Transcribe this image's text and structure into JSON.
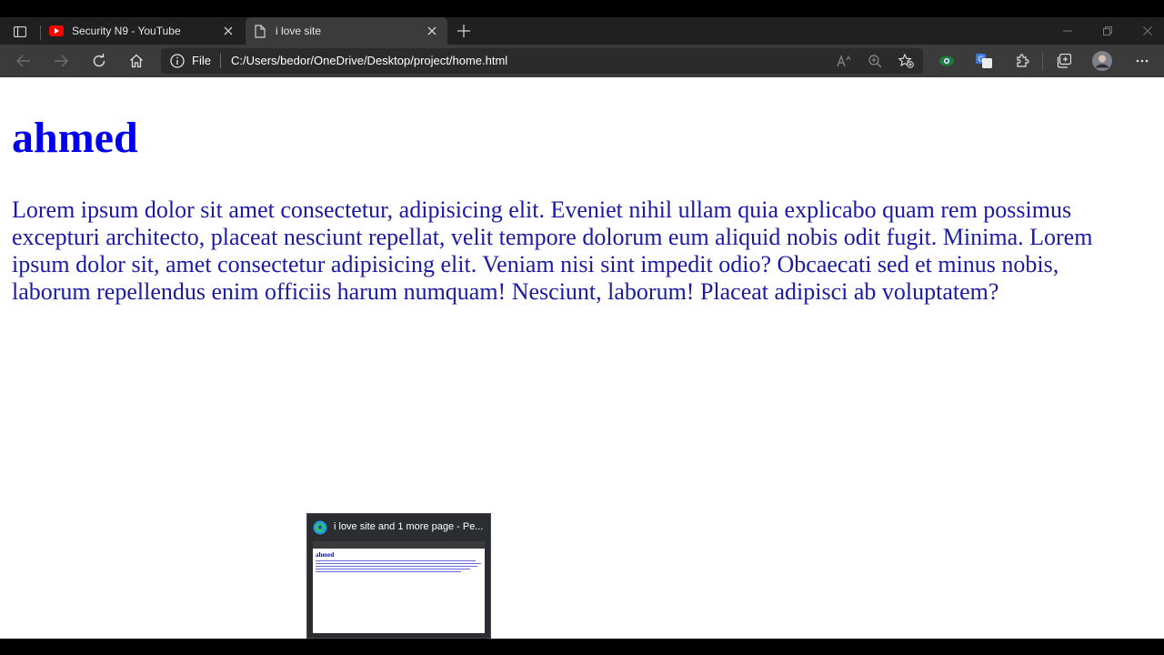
{
  "browser": {
    "tabs": [
      {
        "title": "Security N9 - YouTube",
        "active": false
      },
      {
        "title": "i love site",
        "active": true
      }
    ],
    "address": {
      "scheme_label": "File",
      "url": "C:/Users/bedor/OneDrive/Desktop/project/home.html"
    },
    "accent_colors": {
      "youtube_red": "#ff0000",
      "link_blue": "#0000ee",
      "body_text": "#1a1aa6"
    }
  },
  "page": {
    "heading": "ahmed",
    "paragraph": "Lorem ipsum dolor sit amet consectetur, adipisicing elit. Eveniet nihil ullam quia explicabo quam rem possimus excepturi architecto, placeat nesciunt repellat, velit tempore dolorum eum aliquid nobis odit fugit. Minima. Lorem ipsum dolor sit, amet consectetur adipisicing elit. Veniam nisi sint impedit odio? Obcaecati sed et minus nobis, laborum repellendus enim officiis harum numquam! Nesciunt, laborum! Placeat adipisci ab voluptatem?"
  },
  "taskbar_preview": {
    "title": "i love site and 1 more page - Pe...",
    "thumb_heading": "ahmed"
  }
}
